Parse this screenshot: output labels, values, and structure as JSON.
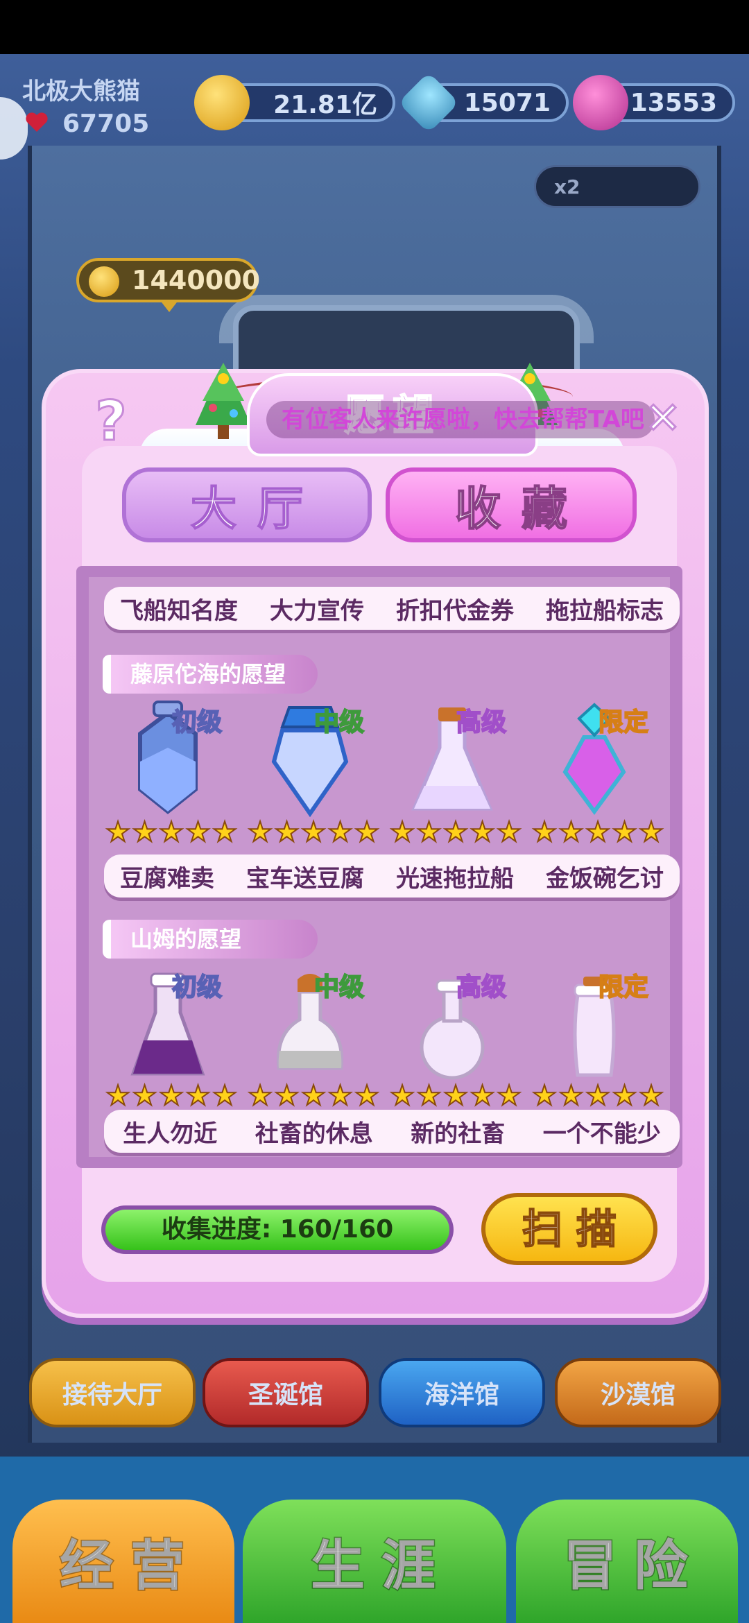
{
  "player": {
    "name": "北极大熊猫",
    "hearts": "67705"
  },
  "currencies": {
    "coins": "21.81亿",
    "gems": "15071",
    "tokens": "13553"
  },
  "scene": {
    "multiplier": "x2",
    "coin_bubble": "1440000"
  },
  "modal": {
    "title": "愿望",
    "help": "?",
    "close": "✕",
    "marquee": "有位客人来许愿啦，快去帮帮TA吧",
    "tabs": {
      "hall": "大厅",
      "favorites": "收藏"
    },
    "top_labels": [
      "飞船知名度",
      "大力宣传",
      "折扣代金券",
      "拖拉船标志"
    ],
    "sections": [
      {
        "title": "藤原佗海的愿望",
        "bottles": [
          {
            "tier": "初级",
            "stars": 5,
            "label": "豆腐难卖"
          },
          {
            "tier": "中级",
            "stars": 5,
            "label": "宝车送豆腐"
          },
          {
            "tier": "高级",
            "stars": 5,
            "label": "光速拖拉船"
          },
          {
            "tier": "限定",
            "stars": 5,
            "label": "金饭碗乞讨"
          }
        ]
      },
      {
        "title": "山姆的愿望",
        "bottles": [
          {
            "tier": "初级",
            "stars": 5,
            "label": "生人勿近"
          },
          {
            "tier": "中级",
            "stars": 5,
            "label": "社畜的休息"
          },
          {
            "tier": "高级",
            "stars": 5,
            "label": "新的社畜"
          },
          {
            "tier": "限定",
            "stars": 5,
            "label": "一个不能少"
          }
        ]
      }
    ],
    "progress": {
      "text": "收集进度: 160/160",
      "current": 160,
      "total": 160
    },
    "scan_button": "扫描"
  },
  "hall_tabs": [
    "接待大厅",
    "圣诞馆",
    "海洋馆",
    "沙漠馆"
  ],
  "main_nav": [
    "经营",
    "生涯",
    "冒险"
  ],
  "colors": {
    "modal_bg": "#efb7ee",
    "tab_active": "#f06fe3",
    "progress_fill": "#36c21a",
    "scan_button": "#f6b711"
  }
}
